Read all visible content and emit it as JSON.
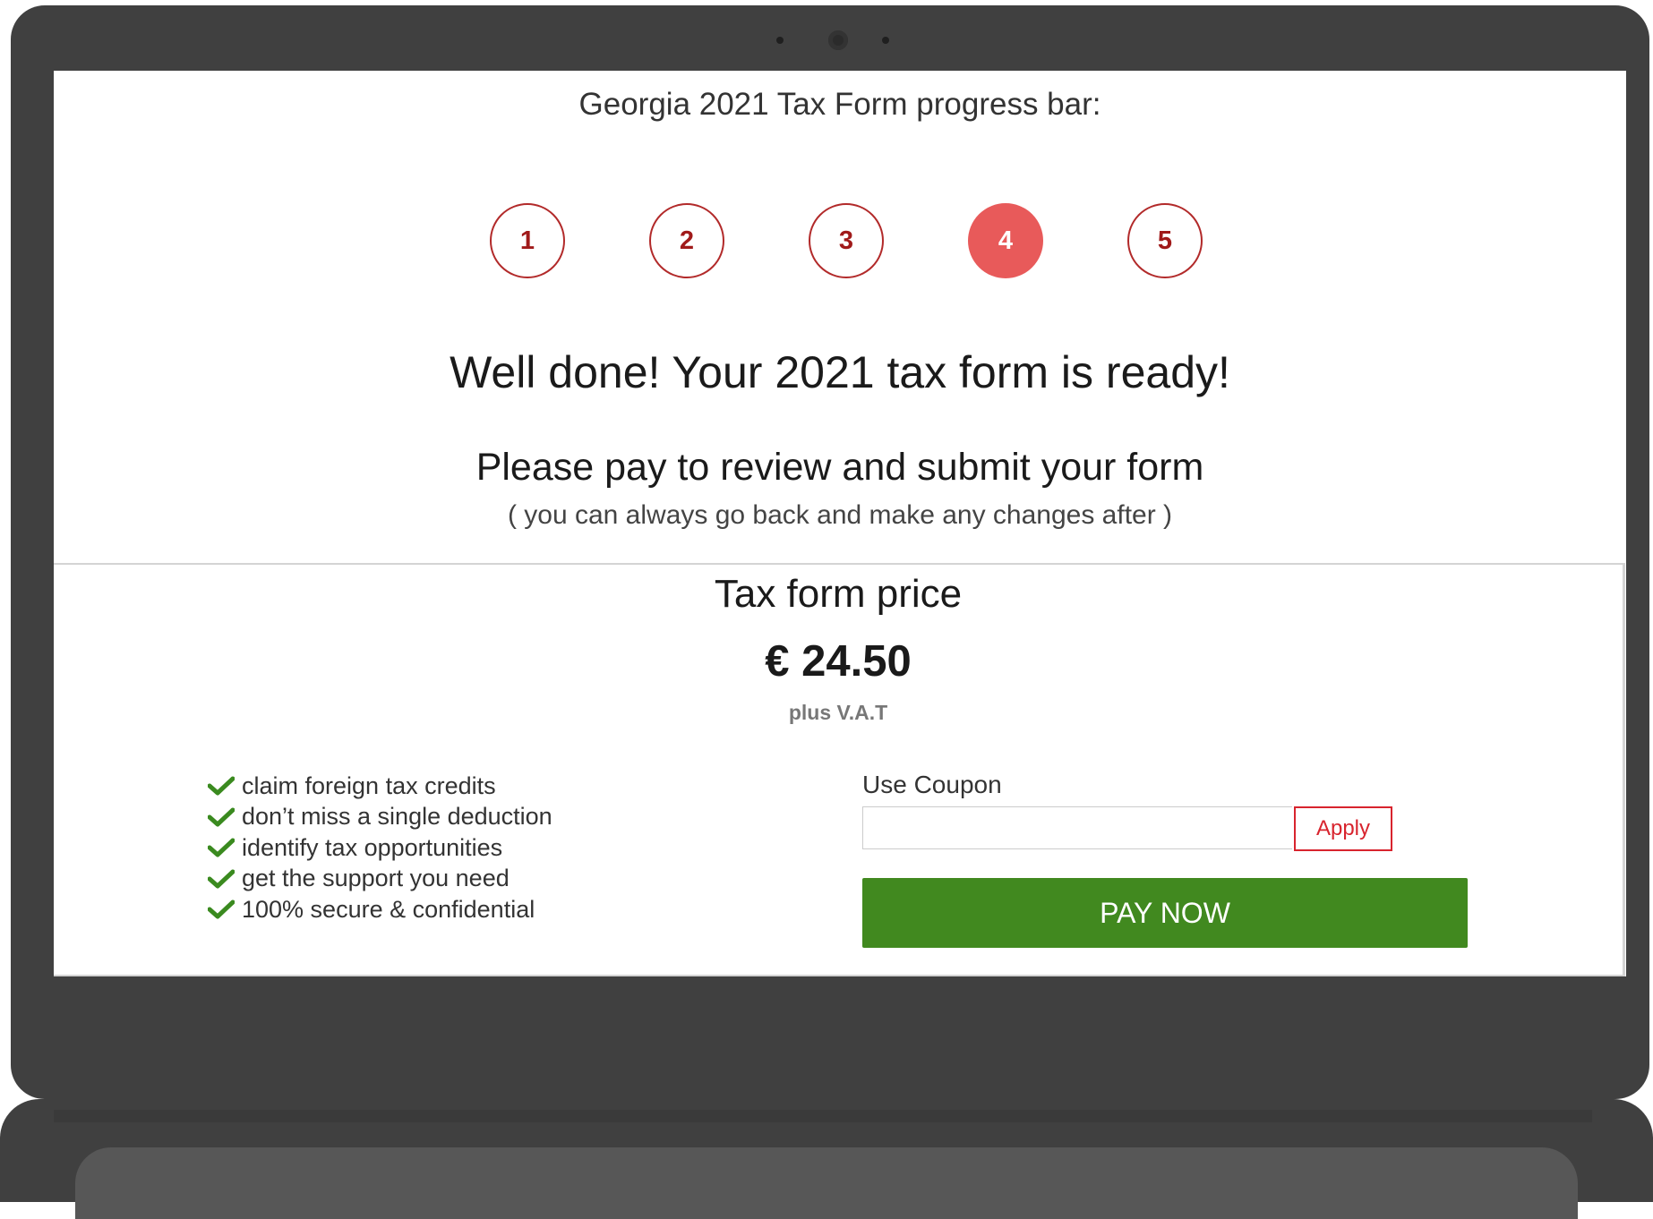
{
  "progress": {
    "title": "Georgia 2021 Tax Form progress bar:",
    "steps": [
      {
        "label": "1"
      },
      {
        "label": "2"
      },
      {
        "label": "3"
      },
      {
        "label": "4"
      },
      {
        "label": "5"
      }
    ],
    "current_step": 4
  },
  "main": {
    "headline": "Well done! Your 2021 tax form is ready!",
    "subheadline": "Please pay to review and submit your form",
    "note": "( you can always go back and make any changes after )"
  },
  "price": {
    "title": "Tax form price",
    "amount": "€ 24.50",
    "vat": "plus V.A.T"
  },
  "benefits": [
    "claim foreign tax credits",
    "don’t miss a single deduction",
    "identify tax opportunities",
    "get the support you need",
    "100% secure & confidential"
  ],
  "coupon": {
    "label": "Use Coupon",
    "value": "",
    "placeholder": "",
    "apply_label": "Apply"
  },
  "pay": {
    "label": "PAY NOW"
  },
  "colors": {
    "accent_red": "#b22a2a",
    "active_step": "#e85a5a",
    "pay_green": "#41891f",
    "check_green": "#3a8a1f",
    "apply_red": "#d8242e",
    "laptop_body": "#404040"
  }
}
